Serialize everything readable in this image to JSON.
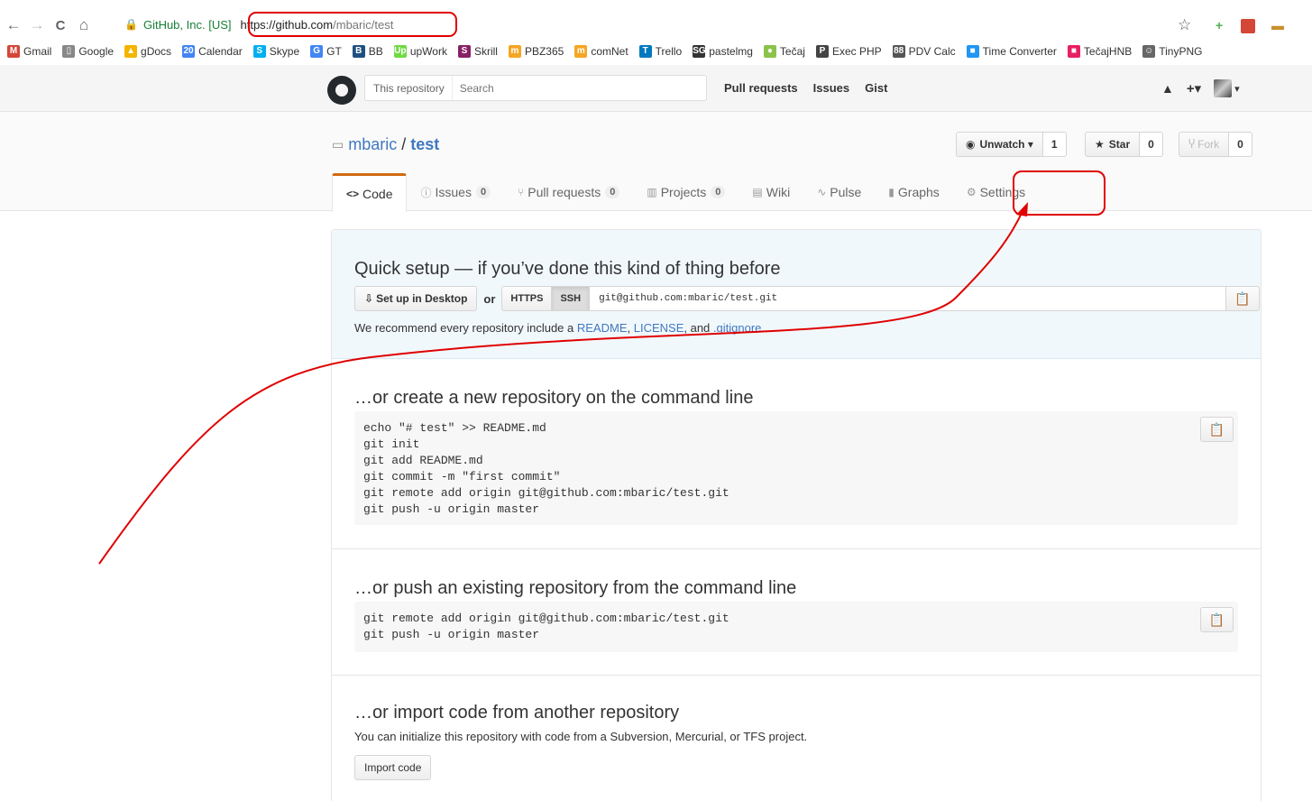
{
  "browser": {
    "back_icon": "←",
    "forward_icon": "→",
    "reload_icon": "C",
    "home_icon": "⌂",
    "site_identity": "GitHub, Inc. [US]",
    "url_host": "https://github.com",
    "url_path": "/mbaric/test",
    "star_icon": "☆",
    "bookmarks": [
      {
        "label": "Gmail",
        "icon": "M",
        "color": "#d44638"
      },
      {
        "label": "Google",
        "icon": "▯",
        "color": "#888888"
      },
      {
        "label": "gDocs",
        "icon": "▲",
        "color": "#f4b400"
      },
      {
        "label": "Calendar",
        "icon": "20",
        "color": "#4285f4"
      },
      {
        "label": "Skype",
        "icon": "S",
        "color": "#00aff0"
      },
      {
        "label": "GT",
        "icon": "G",
        "color": "#4285f4"
      },
      {
        "label": "BB",
        "icon": "B",
        "color": "#205081"
      },
      {
        "label": "upWork",
        "icon": "Up",
        "color": "#6fda44"
      },
      {
        "label": "Skrill",
        "icon": "S",
        "color": "#862165"
      },
      {
        "label": "PBZ365",
        "icon": "m",
        "color": "#f5a623"
      },
      {
        "label": "comNet",
        "icon": "m",
        "color": "#f5a623"
      },
      {
        "label": "Trello",
        "icon": "T",
        "color": "#0079bf"
      },
      {
        "label": "pastelmg",
        "icon": "SG",
        "color": "#333333"
      },
      {
        "label": "Tečaj",
        "icon": "●",
        "color": "#8bc34a"
      },
      {
        "label": "Exec PHP",
        "icon": "P",
        "color": "#444444"
      },
      {
        "label": "PDV Calc",
        "icon": "88",
        "color": "#555555"
      },
      {
        "label": "Time Converter",
        "icon": "■",
        "color": "#2196f3"
      },
      {
        "label": "TečajHNB",
        "icon": "■",
        "color": "#e91e63"
      },
      {
        "label": "TinyPNG",
        "icon": "☺",
        "color": "#666666"
      }
    ]
  },
  "header": {
    "search_scope": "This repository",
    "search_placeholder": "Search",
    "nav": [
      "Pull requests",
      "Issues",
      "Gist"
    ],
    "bell_icon": "🔔",
    "plus_label": "+▾",
    "avatar_caret": "▾"
  },
  "repo": {
    "owner": "mbaric",
    "separator": "/",
    "name": "test",
    "unwatch_label": "Unwatch ▾",
    "watch_count": "1",
    "star_label": "Star",
    "star_count": "0",
    "fork_label": "Fork",
    "fork_count": "0",
    "tabs": [
      {
        "label": "Code",
        "icon": "<>",
        "count": ""
      },
      {
        "label": "Issues",
        "icon": "ⓘ",
        "count": "0"
      },
      {
        "label": "Pull requests",
        "icon": "⑂",
        "count": "0"
      },
      {
        "label": "Projects",
        "icon": "▥",
        "count": "0"
      },
      {
        "label": "Wiki",
        "icon": "▤",
        "count": ""
      },
      {
        "label": "Pulse",
        "icon": "∿",
        "count": ""
      },
      {
        "label": "Graphs",
        "icon": "▮",
        "count": ""
      },
      {
        "label": "Settings",
        "icon": "⚙",
        "count": ""
      }
    ]
  },
  "quick_setup": {
    "title": "Quick setup — if you’ve done this kind of thing before",
    "desktop_button": "Set up in Desktop",
    "or": "or",
    "https_label": "HTTPS",
    "ssh_label": "SSH",
    "clone_url": "git@github.com:mbaric/test.git",
    "note_prefix": "We recommend every repository include a ",
    "readme": "README",
    "comma": ", ",
    "license": "LICENSE",
    "and": ", and ",
    "gitignore": ".gitignore",
    "period": "."
  },
  "sections": {
    "create_title": "…or create a new repository on the command line",
    "create_code": "echo \"# test\" >> README.md\ngit init\ngit add README.md\ngit commit -m \"first commit\"\ngit remote add origin git@github.com:mbaric/test.git\ngit push -u origin master",
    "push_title": "…or push an existing repository from the command line",
    "push_code": "git remote add origin git@github.com:mbaric/test.git\ngit push -u origin master",
    "import_title": "…or import code from another repository",
    "import_note": "You can initialize this repository with code from a Subversion, Mercurial, or TFS project.",
    "import_button": "Import code"
  },
  "annotation_color": "#e00000"
}
